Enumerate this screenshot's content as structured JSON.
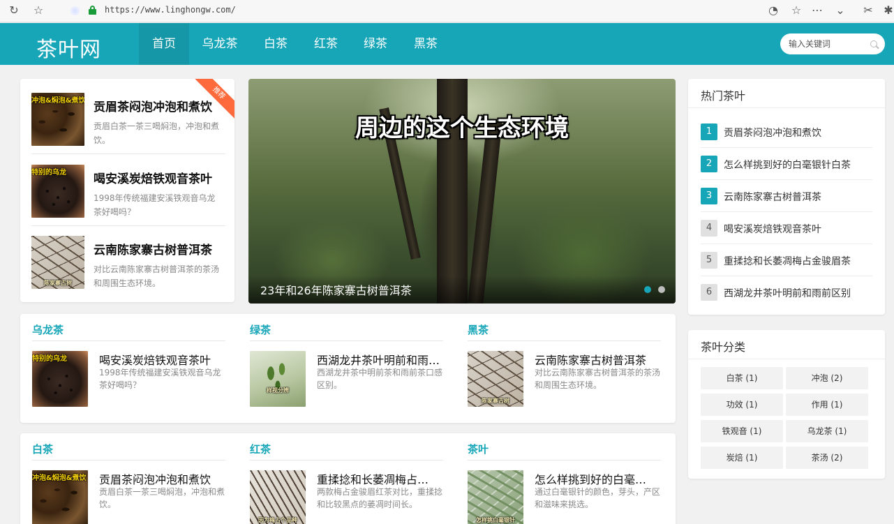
{
  "browser": {
    "url": "https://www.linghongw.com/"
  },
  "nav": {
    "logo": "茶叶网",
    "items": [
      {
        "label": "首页",
        "active": true
      },
      {
        "label": "乌龙茶"
      },
      {
        "label": "白茶"
      },
      {
        "label": "红茶"
      },
      {
        "label": "绿茶"
      },
      {
        "label": "黑茶"
      }
    ],
    "search_placeholder": "输入关键词"
  },
  "featured": {
    "ribbon": "推荐",
    "items": [
      {
        "title": "贡眉茶闷泡冲泡和煮饮",
        "desc": "贡眉白茶一茶三喝焖泡，冲泡和煮饮。",
        "thumb_caption": "冲泡&焖泡&煮饮"
      },
      {
        "title": "喝安溪炭焙铁观音茶叶",
        "desc": "1998年传统福建安溪铁观音乌龙茶好喝吗？",
        "thumb_caption": "特别的乌龙"
      },
      {
        "title": "云南陈家寨古树普洱茶",
        "desc": "对比云南陈家寨古树普洱茶的茶汤和周围生态环境。",
        "thumb_caption": "陈家寨古树"
      }
    ]
  },
  "hero": {
    "caption": "周边的这个生态环境",
    "title": "23年和26年陈家寨古树普洱茶",
    "dots": [
      {
        "active": true,
        "color": "#17a6b8"
      },
      {
        "active": false,
        "color": "#bdbdbd"
      }
    ]
  },
  "sections_row1": [
    {
      "name": "乌龙茶",
      "post_title": "喝安溪炭焙铁观音茶叶",
      "post_desc": "1998年传统福建安溪铁观音乌龙茶好喝吗？",
      "thumb_caption": "特别的乌龙"
    },
    {
      "name": "绿茶",
      "post_title": "西湖龙井茶叶明前和雨前区别",
      "post_desc": "西湖龙井茶中明前茶和雨前茶口感区别。",
      "thumb_caption": "样视分辨"
    },
    {
      "name": "黑茶",
      "post_title": "云南陈家寨古树普洱茶",
      "post_desc": "对比云南陈家寨古树普洱茶的茶汤和周围生态环境。",
      "thumb_caption": "陈家寨古树"
    }
  ],
  "sections_row2": [
    {
      "name": "白茶",
      "post_title": "贡眉茶闷泡冲泡和煮饮",
      "post_desc": "贡眉白茶一茶三喝焖泡，冲泡和煮饮。",
      "thumb_caption": "冲泡&焖泡&煮饮"
    },
    {
      "name": "红茶",
      "post_title": "重揉捻和长萎凋梅占金骏眉茶",
      "post_desc": "两款梅占金骏眉红茶对比，重揉捻和比较黑点的萎凋时间长。",
      "thumb_caption": "因为梅占个品种"
    },
    {
      "name": "茶叶",
      "post_title": "怎么样挑到好的白毫银针白茶",
      "post_desc": "通过白毫银针的颜色，芽头，产区和滋味来挑选。",
      "thumb_caption": "怎样挑白毫银针"
    }
  ],
  "hot": {
    "heading": "热门茶叶",
    "items": [
      {
        "rank": "1",
        "title": "贡眉茶闷泡冲泡和煮饮",
        "hot": true
      },
      {
        "rank": "2",
        "title": "怎么样挑到好的白毫银针白茶",
        "hot": true
      },
      {
        "rank": "3",
        "title": "云南陈家寨古树普洱茶",
        "hot": true
      },
      {
        "rank": "4",
        "title": "喝安溪炭焙铁观音茶叶",
        "hot": false
      },
      {
        "rank": "5",
        "title": "重揉捻和长萎凋梅占金骏眉茶",
        "hot": false
      },
      {
        "rank": "6",
        "title": "西湖龙井茶叶明前和雨前区别",
        "hot": false
      }
    ]
  },
  "categories": {
    "heading": "茶叶分类",
    "tags": [
      "白茶 (1)",
      "冲泡 (2)",
      "功效 (1)",
      "作用 (1)",
      "铁观音 (1)",
      "乌龙茶 (1)",
      "炭焙 (1)",
      "茶汤 (2)"
    ]
  },
  "colors": {
    "accent": "#17a6b8",
    "ribbon": "#ff6a3d"
  }
}
